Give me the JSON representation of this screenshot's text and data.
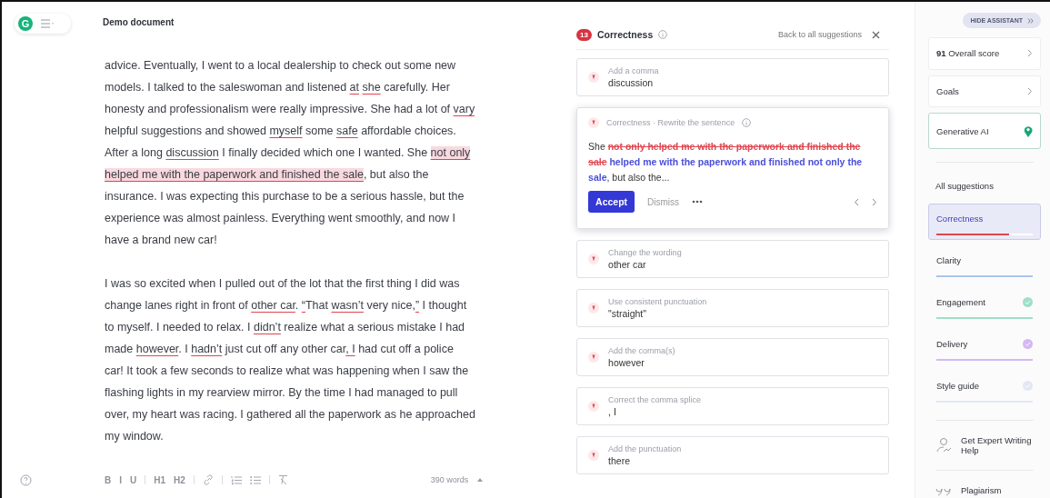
{
  "editor": {
    "logo": "G",
    "title": "Demo document",
    "paragraphs": [
      [
        [
          {
            "kind": "plain",
            "text": "advice. Eventually, I went to a local dealership to check out some new"
          }
        ],
        [
          {
            "kind": "plain",
            "text": "models. I talked to the saleswoman and listened "
          },
          {
            "kind": "flag",
            "text": "at"
          },
          {
            "kind": "flag",
            "text": "she",
            "space_before": true
          },
          {
            "kind": "plain",
            "text": " carefully. Her"
          }
        ],
        [
          {
            "kind": "plain",
            "text": "honesty and professionalism were really impressive. She had a lot of "
          },
          {
            "kind": "flag",
            "text": "vary"
          }
        ],
        [
          {
            "kind": "plain",
            "text": "helpful suggestions and showed "
          },
          {
            "kind": "flag",
            "text": "myself"
          },
          {
            "kind": "plain",
            "text": " some "
          },
          {
            "kind": "flag",
            "text": "safe"
          },
          {
            "kind": "plain",
            "text": " affordable choices."
          }
        ],
        [
          {
            "kind": "plain",
            "text": "After a long "
          },
          {
            "kind": "flag",
            "text": "discussion"
          },
          {
            "kind": "plain",
            "text": " I finally decided which one I wanted. She "
          },
          {
            "kind": "highlight",
            "text": "not only"
          }
        ],
        [
          {
            "kind": "highlight",
            "text": "helped me with the paperwork and finished the sale"
          },
          {
            "kind": "plain",
            "text": ", but also the"
          }
        ],
        [
          {
            "kind": "plain",
            "text": "insurance. I was expecting this purchase to be a serious hassle, but the"
          }
        ],
        [
          {
            "kind": "plain",
            "text": "experience was almost painless. Everything went smoothly, and now I"
          }
        ],
        [
          {
            "kind": "plain",
            "text": "have a brand new car!"
          }
        ]
      ],
      [
        [
          {
            "kind": "plain",
            "text": "I was so excited when I pulled out of the lot that the first thing I did was"
          }
        ],
        [
          {
            "kind": "plain",
            "text": "change lanes right in front of "
          },
          {
            "kind": "flag",
            "text": "other car"
          },
          {
            "kind": "plain",
            "text": ". "
          },
          {
            "kind": "flag",
            "text": "“"
          },
          {
            "kind": "plain",
            "text": "That "
          },
          {
            "kind": "flag",
            "text": "wasn’t"
          },
          {
            "kind": "plain",
            "text": " very nice,"
          },
          {
            "kind": "flag",
            "text": "”"
          },
          {
            "kind": "plain",
            "text": " I thought"
          }
        ],
        [
          {
            "kind": "plain",
            "text": "to myself. I needed to relax. I "
          },
          {
            "kind": "flag",
            "text": "didn’t"
          },
          {
            "kind": "plain",
            "text": " realize what a serious mistake I had"
          }
        ],
        [
          {
            "kind": "plain",
            "text": "made "
          },
          {
            "kind": "flag",
            "text": "however"
          },
          {
            "kind": "plain",
            "text": ". I "
          },
          {
            "kind": "flag",
            "text": "hadn’t"
          },
          {
            "kind": "plain",
            "text": " just cut off any other car"
          },
          {
            "kind": "flag",
            "text": ", I"
          },
          {
            "kind": "plain",
            "text": " had cut off a police"
          }
        ],
        [
          {
            "kind": "plain",
            "text": "car! It took a few seconds to realize what was happening when I saw the"
          }
        ],
        [
          {
            "kind": "plain",
            "text": "flashing lights in my rearview mirror. By the time I had managed to pull"
          }
        ],
        [
          {
            "kind": "plain",
            "text": "over, my heart was racing. I gathered all the paperwork as he approached"
          }
        ],
        [
          {
            "kind": "plain",
            "text": "my window."
          }
        ]
      ]
    ],
    "toolbar": [
      {
        "kind": "text",
        "label": "B"
      },
      {
        "kind": "text",
        "label": "I"
      },
      {
        "kind": "text",
        "label": "U"
      },
      {
        "kind": "divider"
      },
      {
        "kind": "text",
        "label": "H1"
      },
      {
        "kind": "text",
        "label": "H2"
      },
      {
        "kind": "divider"
      },
      {
        "kind": "link"
      },
      {
        "kind": "divider"
      },
      {
        "kind": "numbered-list"
      },
      {
        "kind": "bullet-list"
      },
      {
        "kind": "divider"
      },
      {
        "kind": "clear-format"
      }
    ],
    "word_count": "390 words"
  },
  "suggestions": {
    "count": "13",
    "title": "Correctness",
    "back_link": "Back to all suggestions",
    "cards": [
      {
        "expanded": false,
        "label": "Add a comma",
        "text": "discussion"
      },
      {
        "expanded": true,
        "label": "Correctness · Rewrite the sentence",
        "segments": [
          {
            "kind": "plain",
            "text": "She "
          },
          {
            "kind": "deleted",
            "text": "not only helped me with the paperwork and finished the sale"
          },
          {
            "kind": "inserted",
            "space_before": true,
            "text": "helped me with the paperwork and finished not only the sale"
          },
          {
            "kind": "plain",
            "text": ", but also the..."
          }
        ],
        "accept": "Accept",
        "dismiss": "Dismiss"
      },
      {
        "expanded": false,
        "label": "Change the wording",
        "text": "other car"
      },
      {
        "expanded": false,
        "label": "Use consistent punctuation",
        "text": "\"straight\""
      },
      {
        "expanded": false,
        "label": "Add the comma(s)",
        "text": "however"
      },
      {
        "expanded": false,
        "label": "Correct the comma splice",
        "text": ", I"
      },
      {
        "expanded": false,
        "label": "Add the punctuation",
        "text": "there"
      }
    ]
  },
  "sidebar": {
    "hide_button": "HIDE ASSISTANT",
    "cards": [
      {
        "kind": "score",
        "label": "**91** Overall score"
      },
      {
        "kind": "goals",
        "label": "Goals"
      },
      {
        "kind": "ai",
        "label": "Generative AI"
      }
    ],
    "all_suggestions": "All suggestions",
    "categories": [
      {
        "name": "Correctness",
        "selected": true,
        "color": "#e0454f",
        "level": 0.75,
        "check": false
      },
      {
        "name": "Clarity",
        "selected": false,
        "color": "#a9c4ef",
        "check": false
      },
      {
        "name": "Engagement",
        "selected": false,
        "color": "#9fe0c8",
        "check": true
      },
      {
        "name": "Delivery",
        "selected": false,
        "color": "#d4b8f2",
        "check": true
      },
      {
        "name": "Style guide",
        "selected": false,
        "color": "#e4e7f3",
        "check": true
      }
    ],
    "expert": "Get Expert Writing Help",
    "plagiarism": "Plagiarism"
  }
}
